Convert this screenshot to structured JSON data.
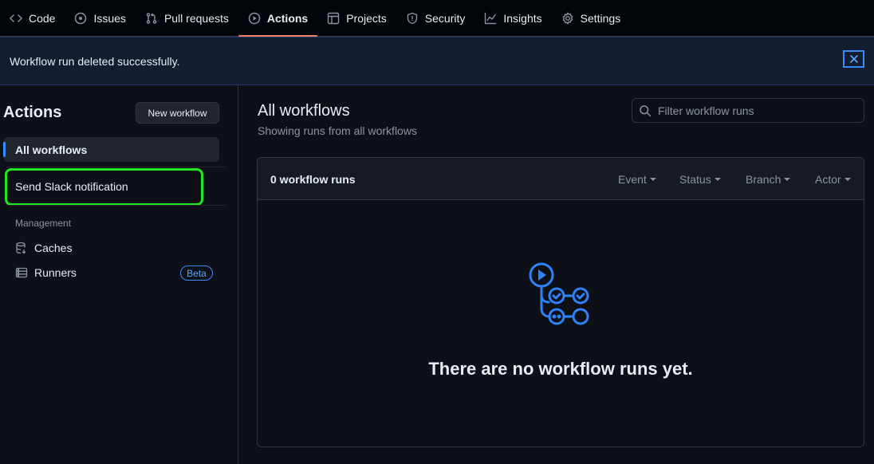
{
  "nav": {
    "tabs": [
      {
        "label": "Code",
        "icon": "code-icon"
      },
      {
        "label": "Issues",
        "icon": "issue-icon"
      },
      {
        "label": "Pull requests",
        "icon": "pull-request-icon"
      },
      {
        "label": "Actions",
        "icon": "play-icon",
        "active": true
      },
      {
        "label": "Projects",
        "icon": "table-icon"
      },
      {
        "label": "Security",
        "icon": "shield-icon"
      },
      {
        "label": "Insights",
        "icon": "graph-icon"
      },
      {
        "label": "Settings",
        "icon": "gear-icon"
      }
    ]
  },
  "flash": {
    "message": "Workflow run deleted successfully."
  },
  "sidebar": {
    "title": "Actions",
    "new_workflow_label": "New workflow",
    "items": [
      {
        "label": "All workflows",
        "active": true
      },
      {
        "label": "Send Slack notification",
        "highlighted": true
      }
    ],
    "management_heading": "Management",
    "management_items": [
      {
        "label": "Caches",
        "icon": "database-icon"
      },
      {
        "label": "Runners",
        "icon": "server-icon",
        "badge": "Beta"
      }
    ]
  },
  "main": {
    "title": "All workflows",
    "subtitle": "Showing runs from all workflows",
    "filter_placeholder": "Filter workflow runs",
    "runs_count": "0 workflow runs",
    "filters": [
      "Event",
      "Status",
      "Branch",
      "Actor"
    ],
    "empty_message": "There are no workflow runs yet."
  },
  "colors": {
    "accent": "#388bfd",
    "active_tab_underline": "#f78166",
    "highlight": "#22e622"
  }
}
